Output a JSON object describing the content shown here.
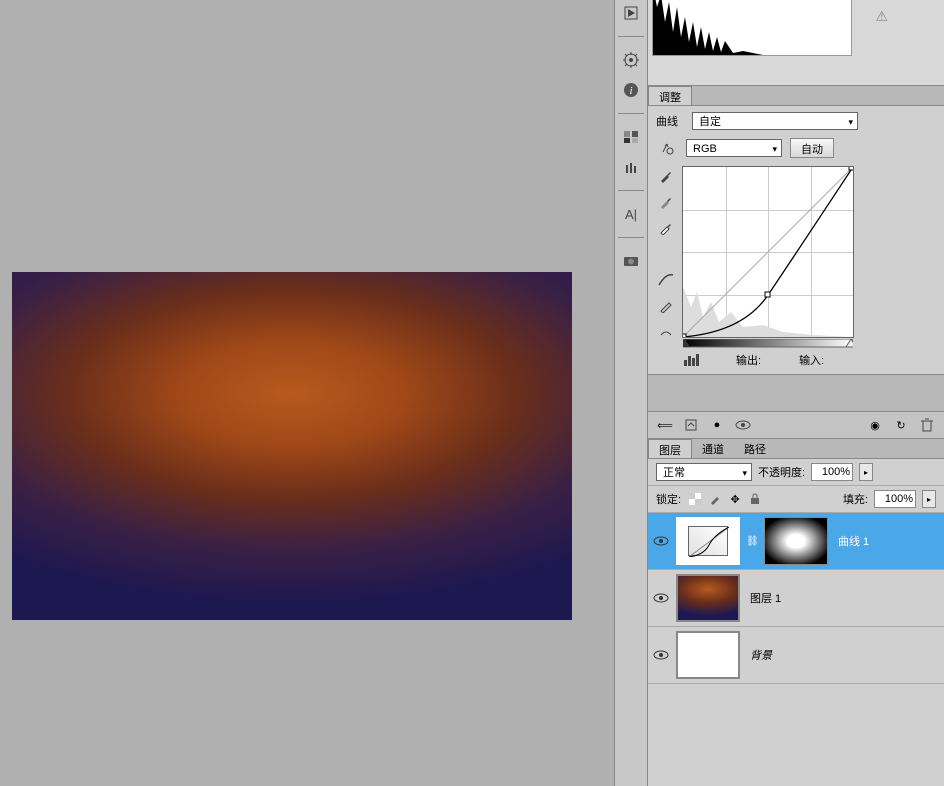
{
  "adjustments": {
    "tab_label": "调整",
    "curves_label": "曲线",
    "preset": "自定",
    "channel": "RGB",
    "auto_btn": "自动",
    "output_label": "输出:",
    "input_label": "输入:",
    "output_value": "",
    "input_value": ""
  },
  "layers_panel": {
    "tabs": {
      "layers": "图层",
      "channels": "通道",
      "paths": "路径"
    },
    "blend_mode": "正常",
    "opacity_label": "不透明度:",
    "opacity_value": "100%",
    "lock_label": "锁定:",
    "fill_label": "填充:",
    "fill_value": "100%",
    "layers": [
      {
        "name": "曲线 1",
        "type": "curves",
        "selected": true
      },
      {
        "name": "图层 1",
        "type": "gradient",
        "selected": false
      },
      {
        "name": "背景",
        "type": "bg",
        "selected": false
      }
    ]
  },
  "chart_data": {
    "type": "line",
    "title": "Curves",
    "xlabel": "Input",
    "ylabel": "Output",
    "xlim": [
      0,
      255
    ],
    "ylim": [
      0,
      255
    ],
    "series": [
      {
        "name": "curve",
        "x": [
          0,
          128,
          255
        ],
        "y": [
          0,
          63,
          255
        ]
      },
      {
        "name": "baseline",
        "x": [
          0,
          255
        ],
        "y": [
          0,
          255
        ]
      }
    ]
  }
}
